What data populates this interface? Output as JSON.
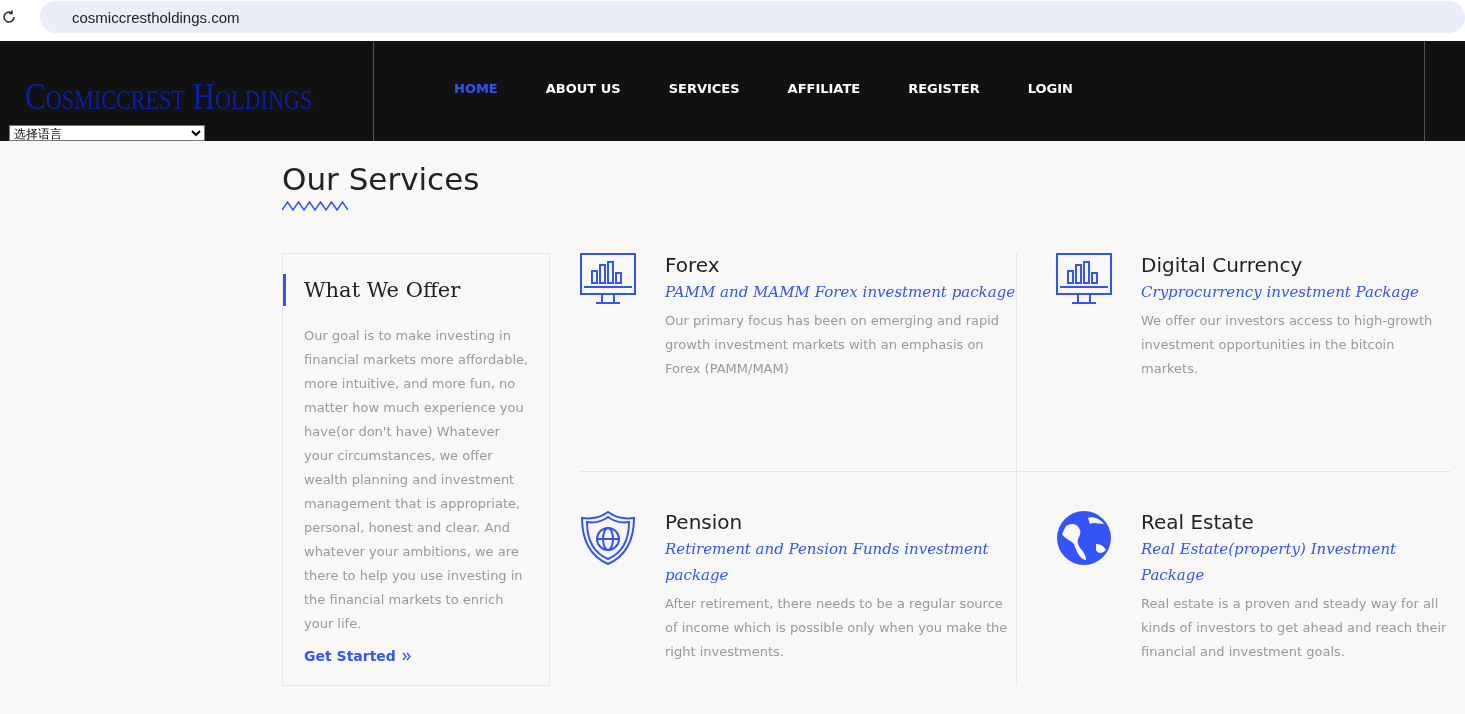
{
  "browser": {
    "url": "cosmiccrestholdings.com"
  },
  "header": {
    "logo": "Cosmiccrest Holdings",
    "language_select": {
      "value": "选择语言"
    },
    "nav": [
      {
        "label": "HOME",
        "selected": true
      },
      {
        "label": "ABOUT US",
        "selected": false
      },
      {
        "label": "SERVICES",
        "selected": false
      },
      {
        "label": "AFFILIATE",
        "selected": false
      },
      {
        "label": "REGISTER",
        "selected": false
      },
      {
        "label": "LOGIN",
        "selected": false
      }
    ]
  },
  "page_title": "Our Services",
  "offer_card": {
    "title": "What We Offer",
    "text": "Our goal is to make investing in financial markets more affordable, more intuitive, and more fun, no matter how much experience you have(or don't have) Whatever your circumstances, we offer wealth planning and investment management that is appropriate, personal, honest and clear. And whatever your ambitions, we are there to help you use investing in the financial markets to enrich your life.",
    "link": "Get Started"
  },
  "services": [
    {
      "kind": "monitor",
      "title": "Forex",
      "subtitle": "PAMM and MAMM Forex investment package",
      "text": "Our primary focus has been on emerging and rapid growth investment markets with an emphasis on Forex (PAMM/MAM)"
    },
    {
      "kind": "monitor",
      "title": "Digital Currency",
      "subtitle": "Cryprocurrency investment Package",
      "text": "We offer our investors access to high-growth investment opportunities in the bitcoin markets."
    },
    {
      "kind": "shield",
      "title": "Pension",
      "subtitle": "Retirement and Pension Funds investment package",
      "text": "After retirement, there needs to be a regular source of income which is possible only when you make the right investments."
    },
    {
      "kind": "globe",
      "title": "Real Estate",
      "subtitle": "Real Estate(property) Investment Package",
      "text": "Real estate is a proven and steady way for all kinds of investors to get ahead and reach their financial and investment goals."
    }
  ]
}
